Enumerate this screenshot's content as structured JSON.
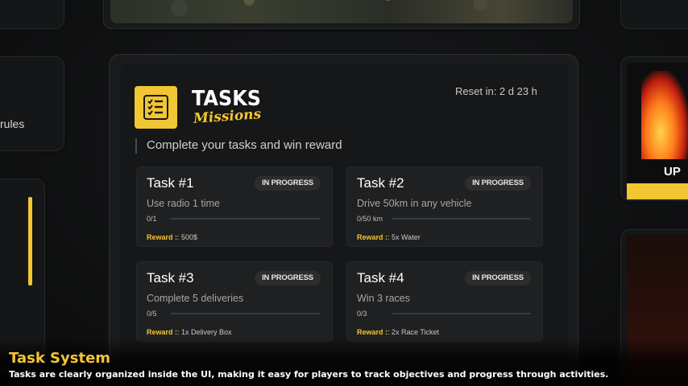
{
  "sidebar": {
    "rules_label": "rules"
  },
  "promo": {
    "label": "UP"
  },
  "header": {
    "logo_icon": "checklist-icon",
    "title": "TASKS",
    "subtitle_script": "Missions",
    "reset_text": "Reset in: 2 d 23 h",
    "tagline": "Complete your tasks and win reward"
  },
  "tasks": [
    {
      "title": "Task #1",
      "status": "IN PROGRESS",
      "description": "Use radio 1 time",
      "progress_text": "0/1",
      "progress_fraction": 0,
      "reward_label": "Reward :",
      "reward_value": ": 500$"
    },
    {
      "title": "Task #2",
      "status": "IN PROGRESS",
      "description": "Drive 50km in any vehicle",
      "progress_text": "0/50 km",
      "progress_fraction": 0,
      "reward_label": "Reward :",
      "reward_value": ": 5x Water"
    },
    {
      "title": "Task #3",
      "status": "IN PROGRESS",
      "description": "Complete 5 deliveries",
      "progress_text": "0/5",
      "progress_fraction": 0,
      "reward_label": "Reward :",
      "reward_value": ": 1x Delivery Box"
    },
    {
      "title": "Task #4",
      "status": "IN PROGRESS",
      "description": "Win 3 races",
      "progress_text": "0/3",
      "progress_fraction": 0,
      "reward_label": "Reward :",
      "reward_value": ": 2x Race Ticket"
    }
  ],
  "caption": {
    "title": "Task System",
    "text": "Tasks are clearly organized inside the UI, making it easy for players to track objectives and progress through activities."
  },
  "colors": {
    "accent": "#f2c533",
    "panel": "#1a1b1c",
    "card": "#1f2021"
  }
}
